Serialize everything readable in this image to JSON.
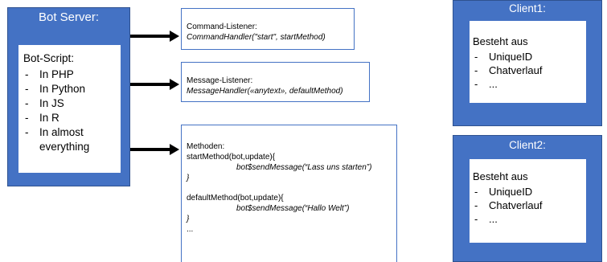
{
  "server": {
    "title": "Bot Server:",
    "script_label": "Bot-Script:",
    "items": [
      "In PHP",
      "In Python",
      "In JS",
      "In R",
      "In almost everything"
    ]
  },
  "command_box": {
    "title": "Command-Listener:",
    "code": "CommandHandler(\"start\", startMethod)"
  },
  "message_box": {
    "title": "Message-Listener:",
    "code": "MessageHandler(«anytext», defaultMethod)"
  },
  "methods_box": {
    "title": "Methoden:",
    "start_sig": "startMethod(bot,update){",
    "start_body": "bot$sendMessage(“Lass uns starten”)",
    "close1": "}",
    "default_sig": "defaultMethod(bot,update){",
    "default_body": "bot$sendMessage(“Hallo Welt”)",
    "close2": "}",
    "ellipsis": "..."
  },
  "client1": {
    "title": "Client1:",
    "label": "Besteht aus",
    "items": [
      "UniqueID",
      "Chatverlauf",
      "..."
    ]
  },
  "client2": {
    "title": "Client2:",
    "label": "Besteht aus",
    "items": [
      "UniqueID",
      "Chatverlauf",
      "..."
    ]
  },
  "colors": {
    "accent": "#4472c4",
    "border": "#2f528f"
  }
}
